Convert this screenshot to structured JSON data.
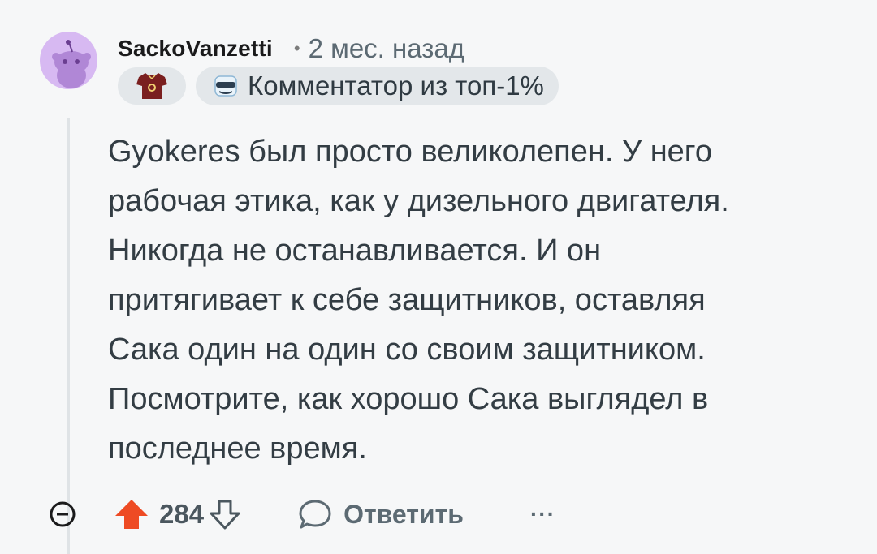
{
  "comment": {
    "username": "SackoVanzetti",
    "separator": "•",
    "time": "2 мес. назад",
    "badge_top": "Комментатор из топ-1%",
    "body": "Gyokeres был просто великолепен. У него\nрабочая этика, как у дизельного двигателя.\nНикогда не останавливается. И он\nпритягивает к себе защитников, оставляя\nСака один на один со своим защитником.\nПосмотрите, как хорошо Сака выглядел в\nпоследнее время."
  },
  "actions": {
    "score": "284",
    "reply_label": "Ответить",
    "more_label": "···"
  },
  "colors": {
    "upvote": "#ee4b24",
    "avatar_bg": "#d7b9f2",
    "shirt": "#7a1f1f"
  },
  "icons": [
    "collapse-icon",
    "upvote-arrow-icon",
    "downvote-arrow-icon",
    "reply-bubble-icon",
    "sunglasses-icon",
    "shirt-icon"
  ]
}
